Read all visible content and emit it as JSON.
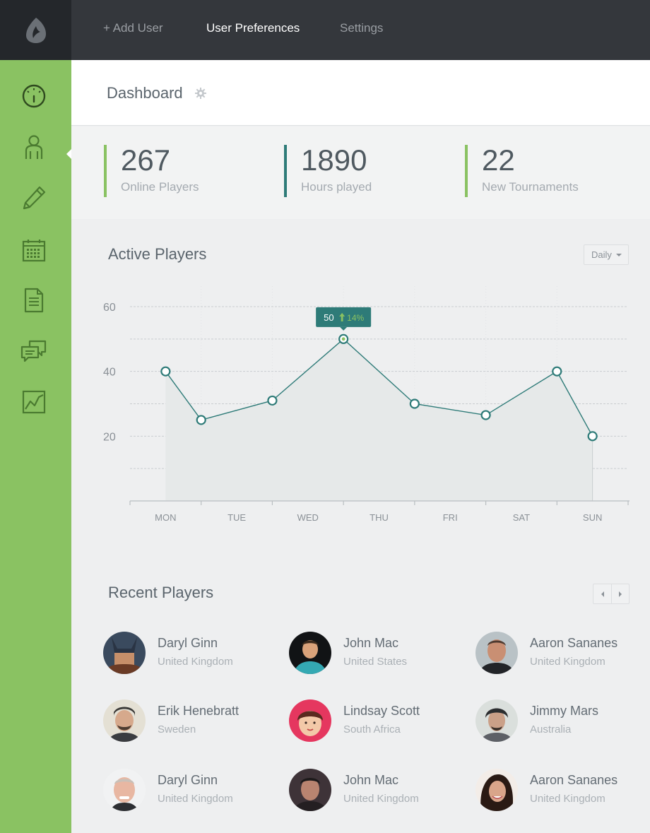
{
  "topbar": {
    "items": [
      {
        "label": "+ Add User",
        "active": false
      },
      {
        "label": "User Preferences",
        "active": true
      },
      {
        "label": "Settings",
        "active": false
      }
    ]
  },
  "sidebar": {
    "icons": [
      "dashboard-gauge-icon",
      "user-icon",
      "pencil-icon",
      "calendar-icon",
      "document-icon",
      "chat-icon",
      "chart-icon"
    ],
    "active": "dashboard-gauge-icon"
  },
  "header": {
    "title": "Dashboard"
  },
  "stats": [
    {
      "value": "267",
      "label": "Online Players",
      "color": "#8ac262"
    },
    {
      "value": "1890",
      "label": "Hours played",
      "color": "#2e7b78"
    },
    {
      "value": "22",
      "label": "New Tournaments",
      "color": "#8ac262"
    }
  ],
  "active_players": {
    "title": "Active Players",
    "period": "Daily",
    "tooltip": {
      "value": "50",
      "change": "14%"
    }
  },
  "chart_data": {
    "type": "area",
    "categories": [
      "MON",
      "TUE",
      "WED",
      "THU",
      "FRI",
      "SAT",
      "SUN"
    ],
    "x_points": [
      0,
      0.5,
      1.5,
      2.5,
      3.5,
      4.5,
      5.5,
      6
    ],
    "values": [
      40,
      25,
      31,
      50,
      30,
      26.5,
      40,
      20
    ],
    "yticks": [
      20,
      40,
      60
    ],
    "ylim": [
      0,
      60
    ],
    "grid": true,
    "colors": {
      "line": "#2e7b78",
      "fill": "#e6e9e9",
      "highlight": "#8ac262"
    }
  },
  "recent_players": {
    "title": "Recent Players",
    "players": [
      {
        "name": "Daryl Ginn",
        "country": "United Kingdom"
      },
      {
        "name": "John Mac",
        "country": "United States"
      },
      {
        "name": "Aaron Sananes",
        "country": "United Kingdom"
      },
      {
        "name": "Erik Henebratt",
        "country": "Sweden"
      },
      {
        "name": "Lindsay Scott",
        "country": "South Africa"
      },
      {
        "name": "Jimmy Mars",
        "country": "Australia"
      },
      {
        "name": "Daryl Ginn",
        "country": "United Kingdom"
      },
      {
        "name": "John Mac",
        "country": "United Kingdom"
      },
      {
        "name": "Aaron Sananes",
        "country": "United Kingdom"
      }
    ]
  }
}
